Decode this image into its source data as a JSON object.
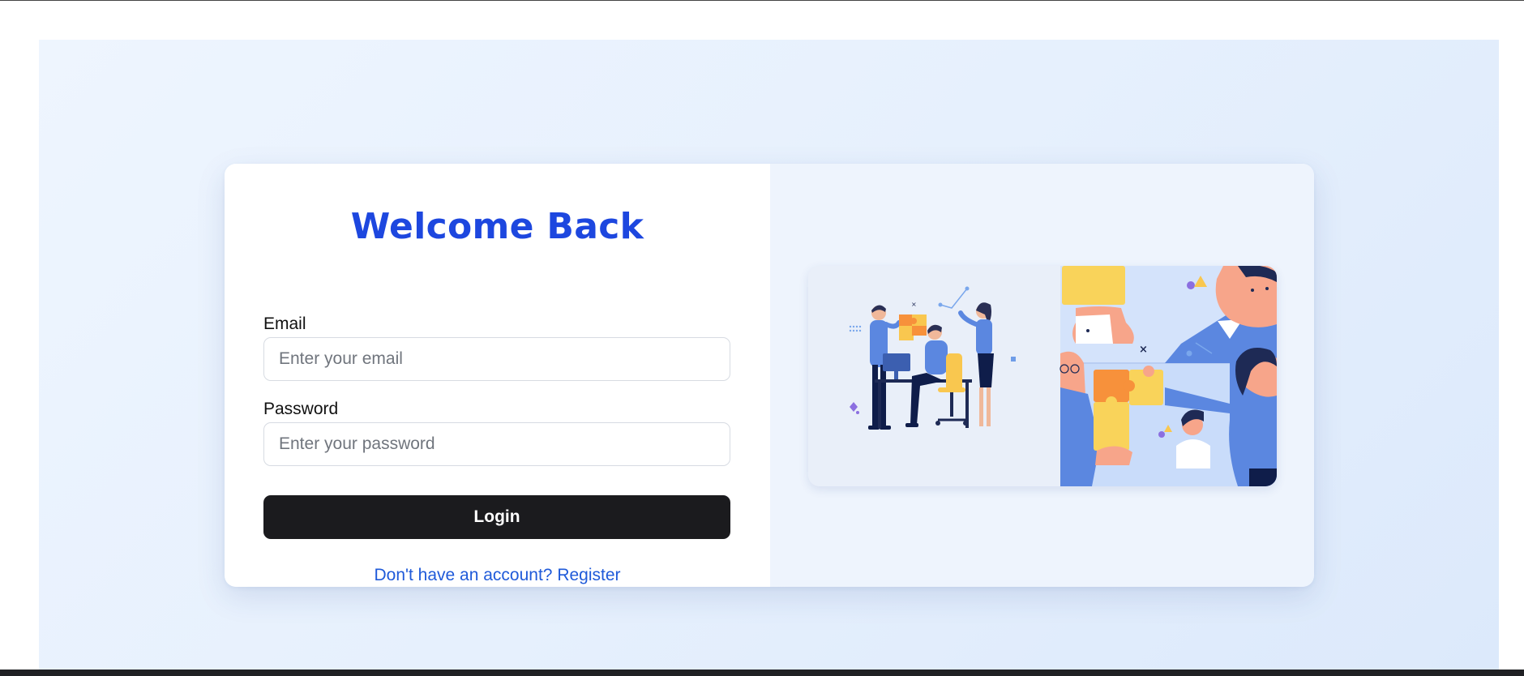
{
  "login": {
    "title": "Welcome Back",
    "email_label": "Email",
    "email_placeholder": "Enter your email",
    "email_value": "",
    "password_label": "Password",
    "password_placeholder": "Enter your password",
    "password_value": "",
    "submit_label": "Login",
    "register_link": "Don't have an account? Register"
  },
  "colors": {
    "title": "#1d47df",
    "button_bg": "#1b1b1e",
    "link": "#1f5ad9",
    "page_bg": "#e6f0fd"
  },
  "illustration": {
    "icon": "teamwork-puzzle-illustration"
  }
}
